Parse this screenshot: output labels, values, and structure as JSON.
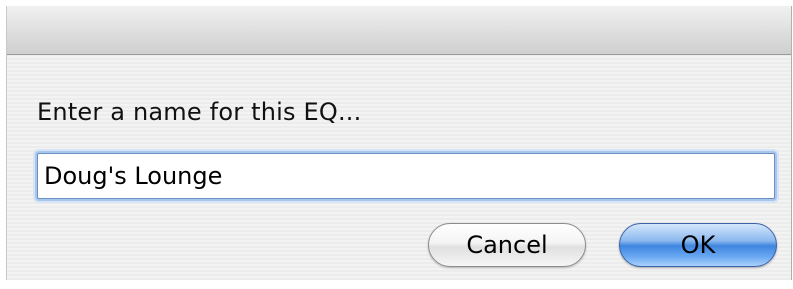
{
  "dialog": {
    "prompt": "Enter a name for this EQ...",
    "name_value": "Doug's Lounge",
    "buttons": {
      "cancel_label": "Cancel",
      "ok_label": "OK"
    }
  },
  "colors": {
    "default_button": "#3f86e0",
    "field_focus": "#a9c6ec",
    "dialog_background": "#ececec"
  }
}
